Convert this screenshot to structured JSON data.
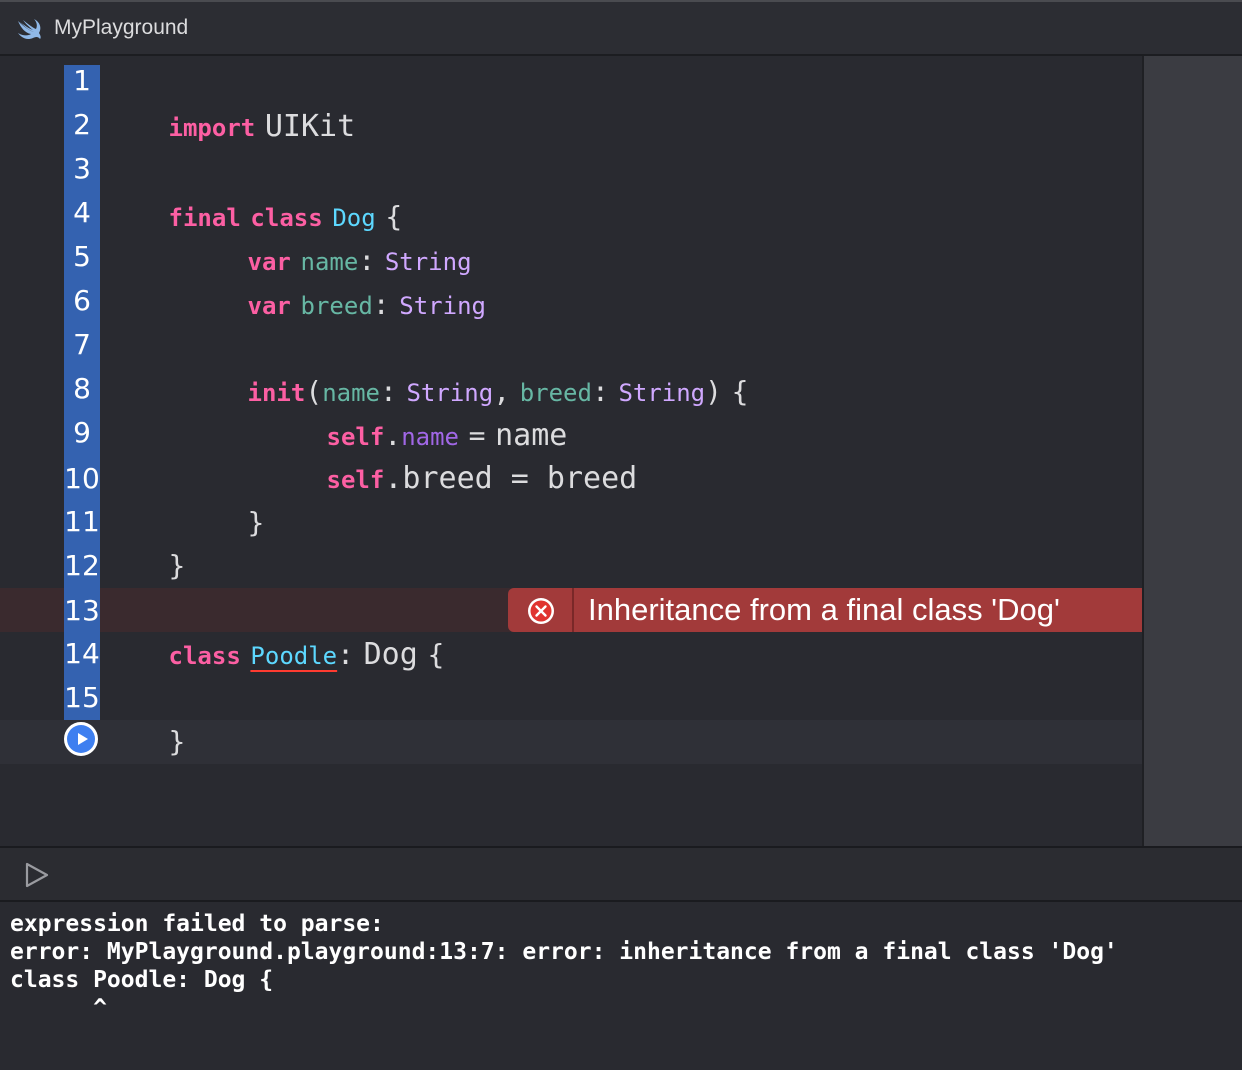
{
  "window": {
    "title": "MyPlayground",
    "icon": "swift-icon"
  },
  "colors": {
    "keyword": "#fc5fa3",
    "declaration": "#5dd8ff",
    "property": "#67b7a4",
    "type": "#d0a8ff",
    "plain": "#dcdcde",
    "gutter": "#3462b0",
    "error": "#a23a3a"
  },
  "line_numbers": [
    "1",
    "2",
    "3",
    "4",
    "5",
    "6",
    "7",
    "8",
    "9",
    "10",
    "11",
    "12",
    "13",
    "14",
    "15"
  ],
  "code": {
    "l1": {
      "kw": "import",
      "name": "UIKit"
    },
    "l3": {
      "kw1": "final",
      "kw2": "class",
      "name": "Dog",
      "brace": "{"
    },
    "l4": {
      "kw": "var",
      "name": "name",
      "colon": ":",
      "type": "String"
    },
    "l5": {
      "kw": "var",
      "name": "breed",
      "colon": ":",
      "type": "String"
    },
    "l7": {
      "kw": "init",
      "open": "(",
      "p1": "name",
      "c1": ":",
      "t1": "String",
      "comma": ",",
      "p2": "breed",
      "c2": ":",
      "t2": "String",
      "close": ")",
      "brace": "{"
    },
    "l8": {
      "self": "self",
      "dot": ".",
      "prop": "name",
      "eq": "=",
      "value": "name"
    },
    "l9": {
      "self": "self",
      "rest": ".breed = breed"
    },
    "l10": {
      "brace": "}"
    },
    "l11": {
      "brace": "}"
    },
    "l13": {
      "kw": "class",
      "name": "Poodle",
      "colon": ":",
      "super": "Dog",
      "brace": "{"
    },
    "l15": {
      "brace": "}"
    }
  },
  "error_banner": {
    "icon": "error-x-icon",
    "message": "Inheritance from a final class 'Dog'"
  },
  "debug": {
    "run_icon": "play-outline-icon"
  },
  "console_output": [
    "expression failed to parse:",
    "error: MyPlayground.playground:13:7: error: inheritance from a final class 'Dog'",
    "class Poodle: Dog {",
    "      ^"
  ]
}
